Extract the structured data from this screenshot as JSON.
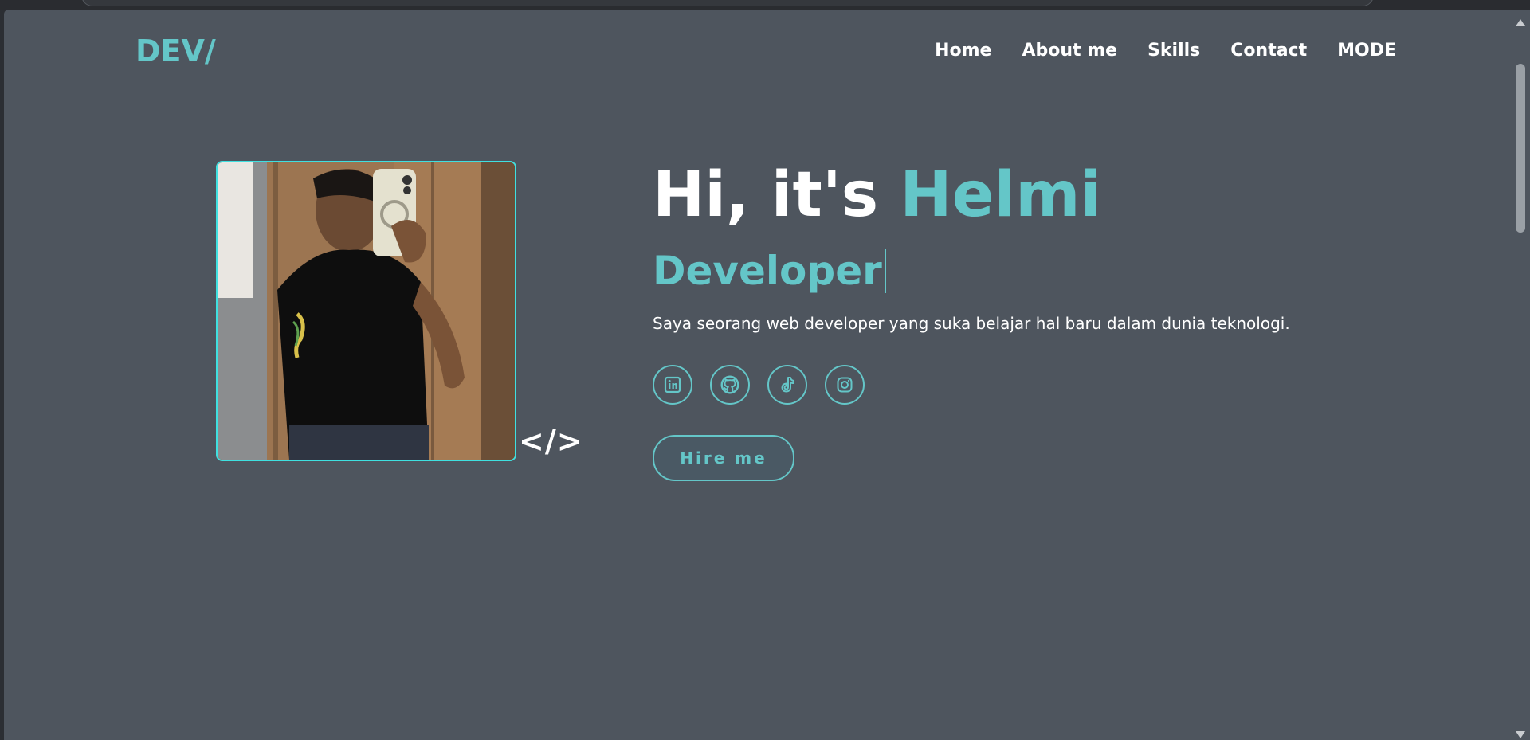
{
  "header": {
    "logo": "DEV/",
    "nav": [
      "Home",
      "About me",
      "Skills",
      "Contact",
      "MODE"
    ]
  },
  "hero": {
    "greeting": "Hi, it's ",
    "name": "Helmi",
    "role": "Developer",
    "description": "Saya seorang web developer yang suka belajar hal baru dalam dunia teknologi.",
    "code_symbol": "</>",
    "cta_label": "Hire me"
  },
  "socials": [
    {
      "icon": "linkedin-icon"
    },
    {
      "icon": "github-icon"
    },
    {
      "icon": "tiktok-icon"
    },
    {
      "icon": "instagram-icon"
    }
  ],
  "colors": {
    "accent": "#64c6c8",
    "background": "#4e555e",
    "text": "#ffffff",
    "photo_border": "#3fe0e0"
  }
}
